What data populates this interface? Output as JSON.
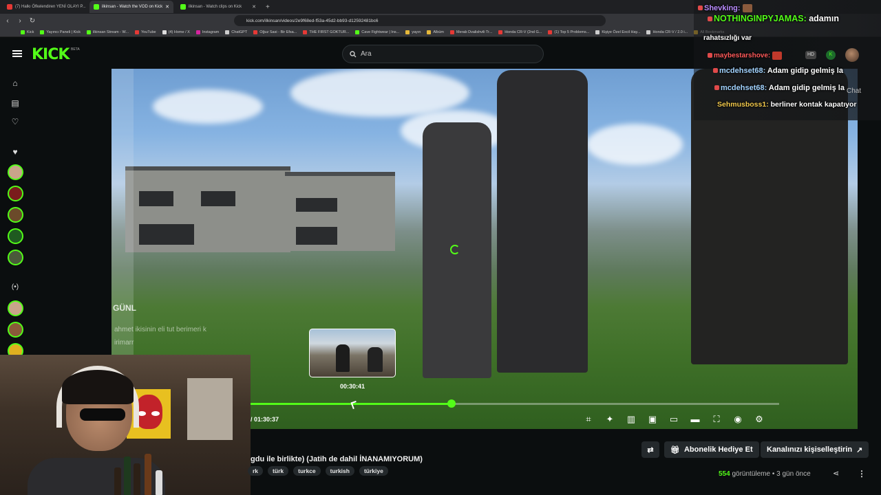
{
  "browser": {
    "tabs": [
      {
        "title": "(7) Halkı Öfkelendiren YENİ OLAYI P...",
        "color": "#e53935"
      },
      {
        "title": "ilkinsan - Watch the VOD on Kick",
        "color": "#53fc18"
      },
      {
        "title": "ilkinsan - Watch clips on Kick",
        "color": "#53fc18"
      }
    ],
    "url": "kick.com/ilkinsan/videos/2e9f68ed-f53a-45d2-bb93-d12592481bc6",
    "bookmarks": [
      {
        "label": "Kick",
        "color": "#53fc18"
      },
      {
        "label": "Yayıncı Paneli | Kick",
        "color": "#53fc18"
      },
      {
        "label": "ilkinsan Stream - W...",
        "color": "#53fc18"
      },
      {
        "label": "YouTube",
        "color": "#e53935"
      },
      {
        "label": "(4) Home / X",
        "color": "#dddddd"
      },
      {
        "label": "Instagram",
        "color": "#d6249f"
      },
      {
        "label": "ChatGPT",
        "color": "#cccccc"
      },
      {
        "label": "Oğuz Sasi - Bir Efsa...",
        "color": "#e53935"
      },
      {
        "label": "THE FIRST GOKTUR...",
        "color": "#e53935"
      },
      {
        "label": "Cave Fightwear | Ins...",
        "color": "#53fc18"
      },
      {
        "label": "yayın",
        "color": "#e5b83a"
      },
      {
        "label": "Albüm",
        "color": "#e5b83a"
      },
      {
        "label": "Merab Dvalishvili Tr...",
        "color": "#e53935"
      },
      {
        "label": "Honda CR-V (2nd G...",
        "color": "#e53935"
      },
      {
        "label": "(1) Top 5 Problems...",
        "color": "#e53935"
      },
      {
        "label": "Kişiye Özel Excil Hay...",
        "color": "#cccccc"
      },
      {
        "label": "Honda CR-V / 2.0 i...",
        "color": "#cccccc"
      },
      {
        "label": "All Bookmarks",
        "color": "#e5b83a"
      }
    ]
  },
  "header": {
    "logo": "KICK",
    "beta": "BETA",
    "search_placeholder": "Ara"
  },
  "video": {
    "overlay_title": "GÜNL",
    "overlay_chat": [
      "ahmet ikisinin eli tut berimeri k",
      "irimarr"
    ],
    "hover_time": "00:30:41",
    "time_display": "/ 01:30:37",
    "progress_fraction": 0.382
  },
  "chat_overlay": {
    "label": "Chat",
    "messages": [
      {
        "user": "Shevking:",
        "text": "",
        "color": "#b98cff"
      },
      {
        "user": "NOTHINGINPYJAMAS:",
        "text": "adamın",
        "color": "#53fc18"
      },
      {
        "user": "",
        "text": "rahatsızlığı var",
        "color": "#ffffff"
      },
      {
        "user": "maybestarshove:",
        "text": "",
        "color": "#ff5a5a"
      },
      {
        "user": "mcdehset68:",
        "text": "Adam gidip gelmiş la",
        "color": "#a3d4ff"
      },
      {
        "user": "mcdehset68:",
        "text": "Adam gidip gelmiş la",
        "color": "#a3d4ff"
      },
      {
        "user": "Sehmusboss1:",
        "text": "berliner kontak kapatıyor",
        "color": "#f2c94c"
      }
    ]
  },
  "below": {
    "title": "gdu ile birlikte) (Jatih de dahil İNANAMIYORUM)",
    "tags": [
      "rk",
      "türk",
      "turkce",
      "turkish",
      "türkiye"
    ],
    "gift_button": "Abonelik Hediye Et",
    "customize_button": "Kanalınızı kişiselleştirin",
    "views_count": "554",
    "views_label": "görüntüleme",
    "separator": "•",
    "age": "3 gün önce"
  }
}
